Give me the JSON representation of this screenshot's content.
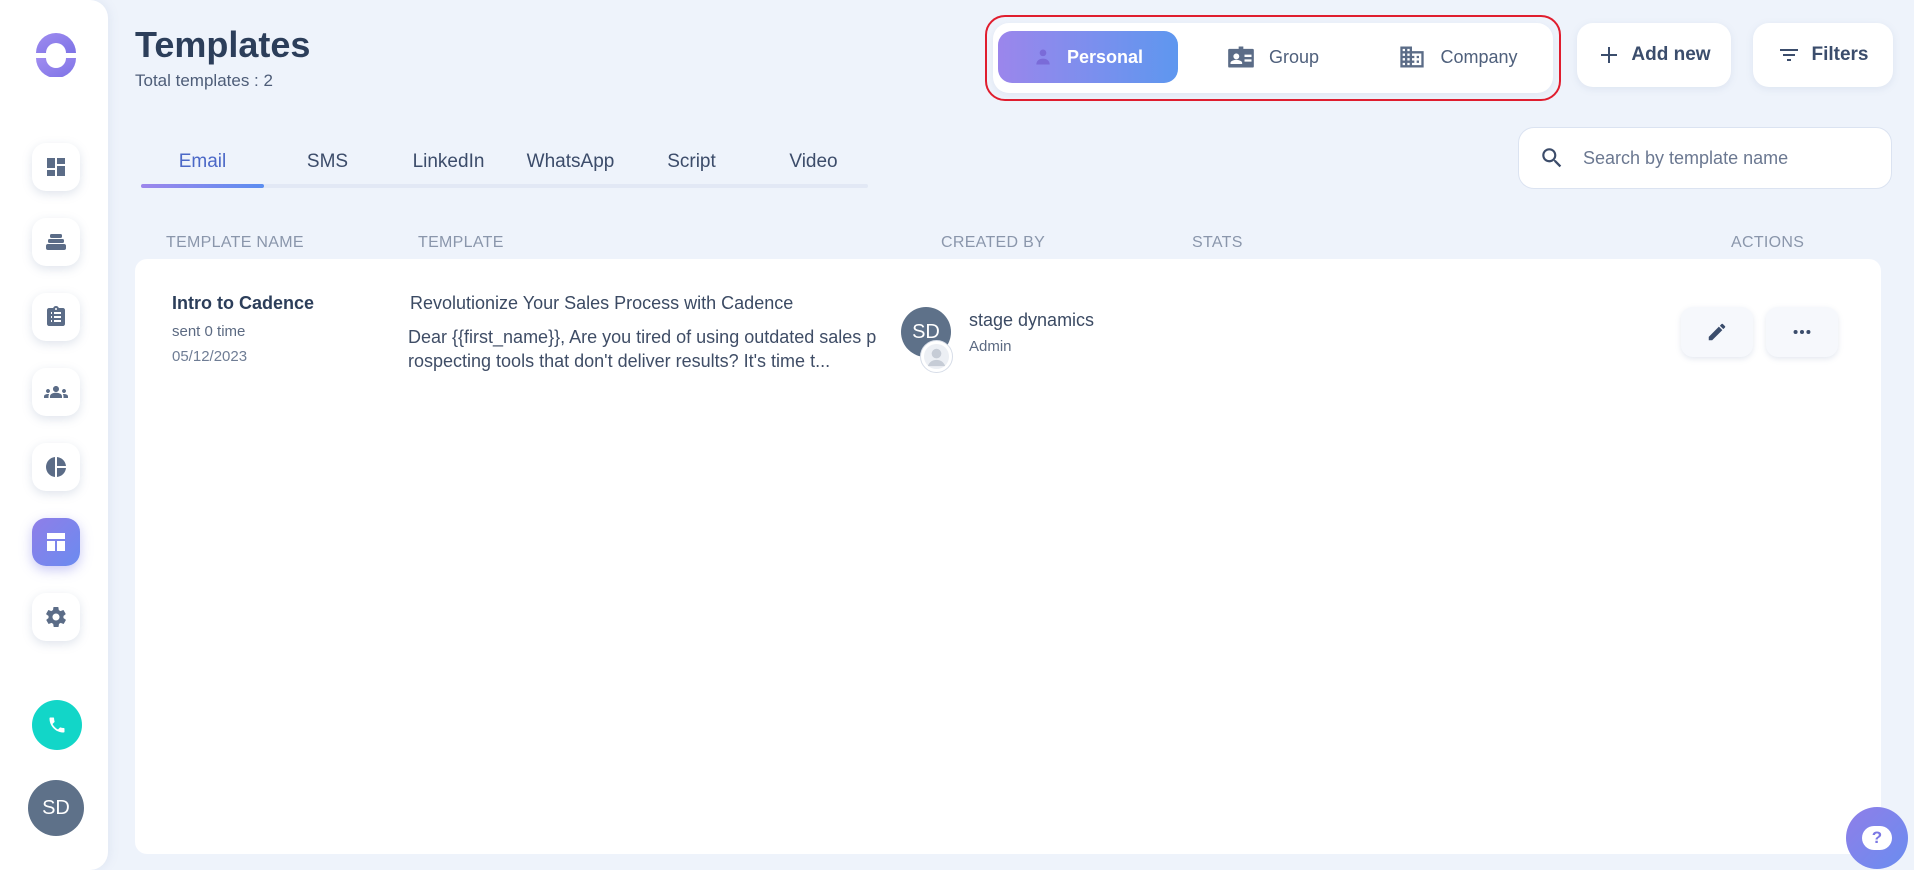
{
  "sidebar": {
    "nav": [
      {
        "icon": "dashboard-icon"
      },
      {
        "icon": "cadence-stack-icon"
      },
      {
        "icon": "clipboard-task-icon"
      },
      {
        "icon": "people-icon"
      },
      {
        "icon": "pie-chart-icon"
      },
      {
        "icon": "templates-layout-icon",
        "active": true
      },
      {
        "icon": "gear-icon"
      }
    ],
    "phone_icon": "phone-icon",
    "avatar_initials": "SD"
  },
  "header": {
    "title": "Templates",
    "subtitle": "Total templates : 2",
    "owner_toggle": {
      "options": [
        {
          "label": "Personal",
          "icon": "person-icon",
          "active": true
        },
        {
          "label": "Group",
          "icon": "id-card-icon",
          "active": false
        },
        {
          "label": "Company",
          "icon": "building-icon",
          "active": false
        }
      ]
    },
    "add_new_label": "Add new",
    "filters_label": "Filters"
  },
  "tabs": [
    {
      "label": "Email",
      "active": true
    },
    {
      "label": "SMS",
      "active": false
    },
    {
      "label": "LinkedIn",
      "active": false
    },
    {
      "label": "WhatsApp",
      "active": false
    },
    {
      "label": "Script",
      "active": false
    },
    {
      "label": "Video",
      "active": false
    }
  ],
  "search": {
    "placeholder": "Search by template name",
    "value": ""
  },
  "table": {
    "columns": [
      "TEMPLATE NAME",
      "TEMPLATE",
      "CREATED BY",
      "STATS",
      "ACTIONS"
    ],
    "rows": [
      {
        "name": "Intro to Cadence",
        "sent": "sent 0 time",
        "date": "05/12/2023",
        "subject": "Revolutionize Your Sales Process with Cadence",
        "body": "Dear {{first_name}},   Are you tired of using outdated sales prospecting tools that don't deliver results? It's time t...",
        "creator_initials": "SD",
        "creator_name": "stage dynamics",
        "creator_role": "Admin"
      }
    ]
  },
  "colors": {
    "accent_start": "#9b86ec",
    "accent_end": "#5e97ef",
    "highlight_border": "#e01d2e",
    "phone_button": "#12d6c8"
  }
}
